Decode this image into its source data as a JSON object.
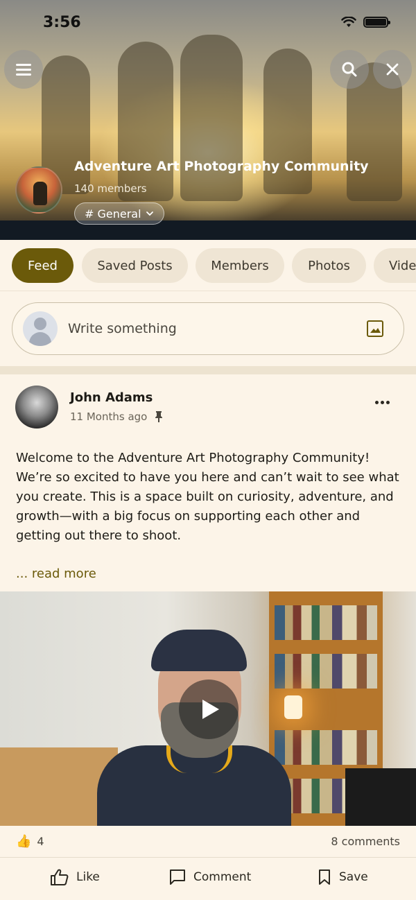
{
  "status_bar": {
    "time": "3:56"
  },
  "header": {
    "community_name": "Adventure Art Photography Community",
    "member_count": "140 members",
    "channel": "# General"
  },
  "tabs": [
    {
      "label": "Feed",
      "active": true
    },
    {
      "label": "Saved Posts",
      "active": false
    },
    {
      "label": "Members",
      "active": false
    },
    {
      "label": "Photos",
      "active": false
    },
    {
      "label": "Vide",
      "active": false
    }
  ],
  "composer": {
    "placeholder": "Write something"
  },
  "post": {
    "author": "John Adams",
    "time": "11 Months ago",
    "body": "Welcome to the Adventure Art Photography Community! We’re so excited to have you here and can’t wait to see what you create. This is a space built on curiosity, adventure, and growth—with a big focus on supporting each other and getting out there to shoot.",
    "read_more": "... read more",
    "reactions": "4",
    "reaction_icon": "👍",
    "comments": "8 comments"
  },
  "actions": {
    "like": "Like",
    "comment": "Comment",
    "save": "Save"
  },
  "colors": {
    "accent": "#6b5a0a",
    "background": "#fcf4e8",
    "tab_inactive": "#efe5d4"
  }
}
